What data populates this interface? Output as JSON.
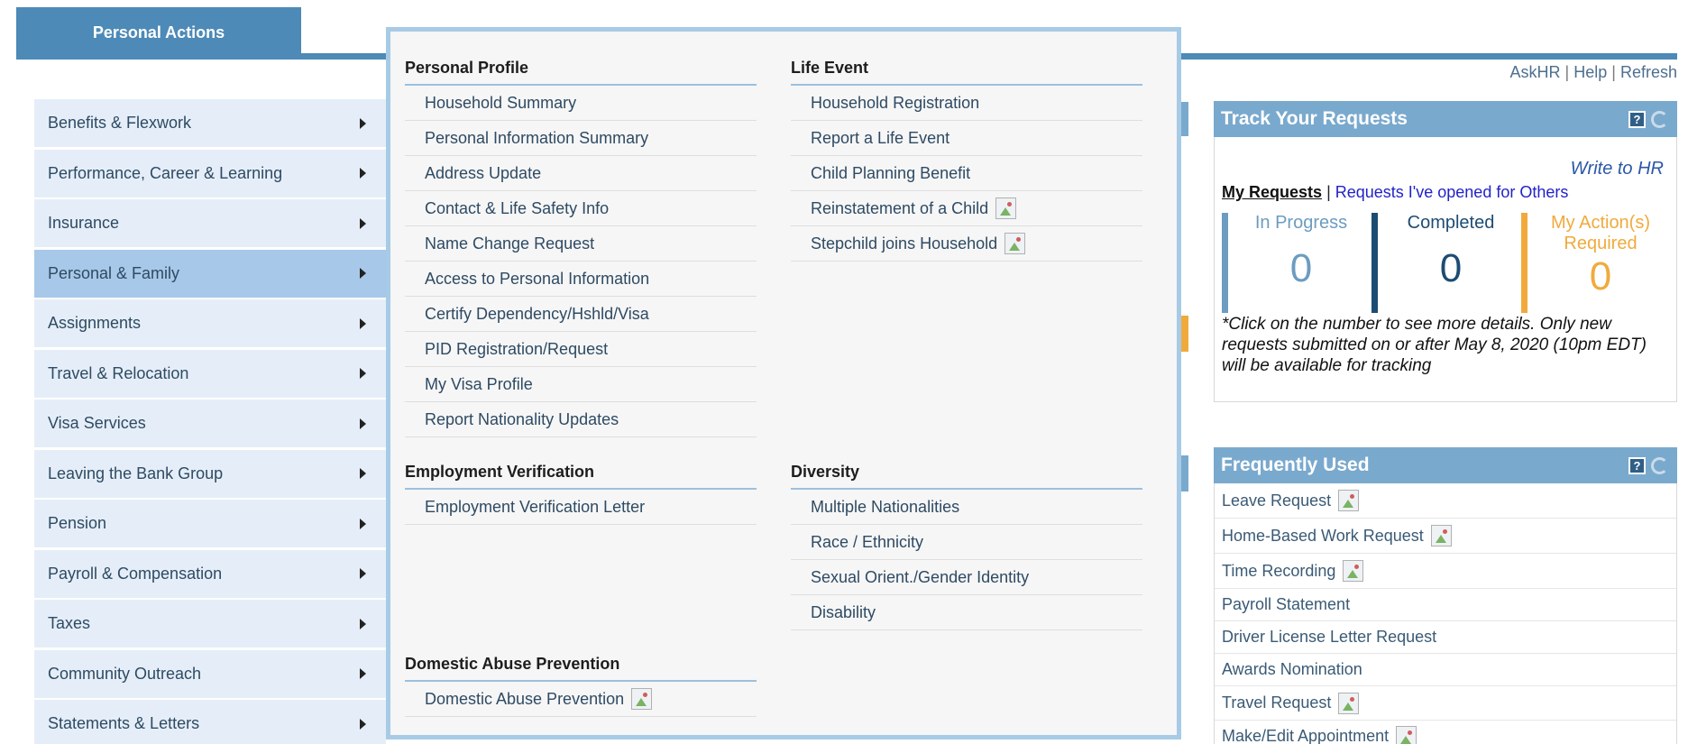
{
  "top_tab": {
    "label": "Personal Actions"
  },
  "util_links": {
    "askhr": "AskHR",
    "help": "Help",
    "refresh": "Refresh",
    "separator": "|"
  },
  "left_menu": [
    {
      "label": "Benefits & Flexwork"
    },
    {
      "label": "Performance, Career & Learning"
    },
    {
      "label": "Insurance"
    },
    {
      "label": "Personal & Family"
    },
    {
      "label": "Assignments"
    },
    {
      "label": "Travel & Relocation"
    },
    {
      "label": "Visa Services"
    },
    {
      "label": "Leaving the Bank Group"
    },
    {
      "label": "Pension"
    },
    {
      "label": "Payroll & Compensation"
    },
    {
      "label": "Taxes"
    },
    {
      "label": "Community Outreach"
    },
    {
      "label": "Statements & Letters"
    }
  ],
  "flyout": {
    "personal_profile": {
      "title": "Personal Profile",
      "links": [
        "Household Summary",
        "Personal Information Summary",
        "Address Update",
        "Contact & Life Safety Info",
        "Name Change Request",
        "Access to Personal Information",
        "Certify Dependency/Hshld/Visa",
        "PID Registration/Request",
        "My Visa Profile",
        "Report Nationality Updates"
      ]
    },
    "life_event": {
      "title": "Life Event",
      "links": [
        "Household Registration",
        "Report a Life Event",
        "Child Planning Benefit",
        "Reinstatement of a Child",
        "Stepchild joins Household"
      ]
    },
    "employment_verification": {
      "title": "Employment Verification",
      "links": [
        "Employment Verification Letter"
      ]
    },
    "diversity": {
      "title": "Diversity",
      "links": [
        "Multiple Nationalities",
        "Race / Ethnicity",
        "Sexual Orient./Gender Identity",
        "Disability"
      ]
    },
    "domestic_abuse": {
      "title": "Domestic Abuse Prevention",
      "links": [
        "Domestic Abuse Prevention"
      ]
    }
  },
  "track_requests": {
    "title": "Track Your Requests",
    "help_icon": "?",
    "write_to_hr": "Write to HR",
    "tab_mine": "My Requests",
    "tab_separator": "|",
    "tab_others": "Requests I've opened for Others",
    "in_progress_label": "In Progress",
    "in_progress_count": "0",
    "completed_label": "Completed",
    "completed_count": "0",
    "action_label_1": "My Action(s)",
    "action_label_2": "Required",
    "action_count": "0",
    "note": "*Click on the number to see more details. Only new requests submitted on or after May 8, 2020 (10pm EDT) will be available for tracking"
  },
  "frequently_used": {
    "title": "Frequently Used",
    "help_icon": "?",
    "items": [
      "Leave Request",
      "Home-Based Work Request",
      "Time Recording",
      "Payroll Statement",
      "Driver License Letter Request",
      "Awards Nomination",
      "Travel Request",
      "Make/Edit Appointment"
    ]
  },
  "colors": {
    "brand_blue": "#4d8ab7",
    "widget_header": "#7aa9ce",
    "menu_bg": "#e5eef8",
    "menu_active": "#a7c8e8",
    "in_progress": "#6c9cc0",
    "completed": "#1d4c73",
    "action_required": "#f0aa3c"
  }
}
